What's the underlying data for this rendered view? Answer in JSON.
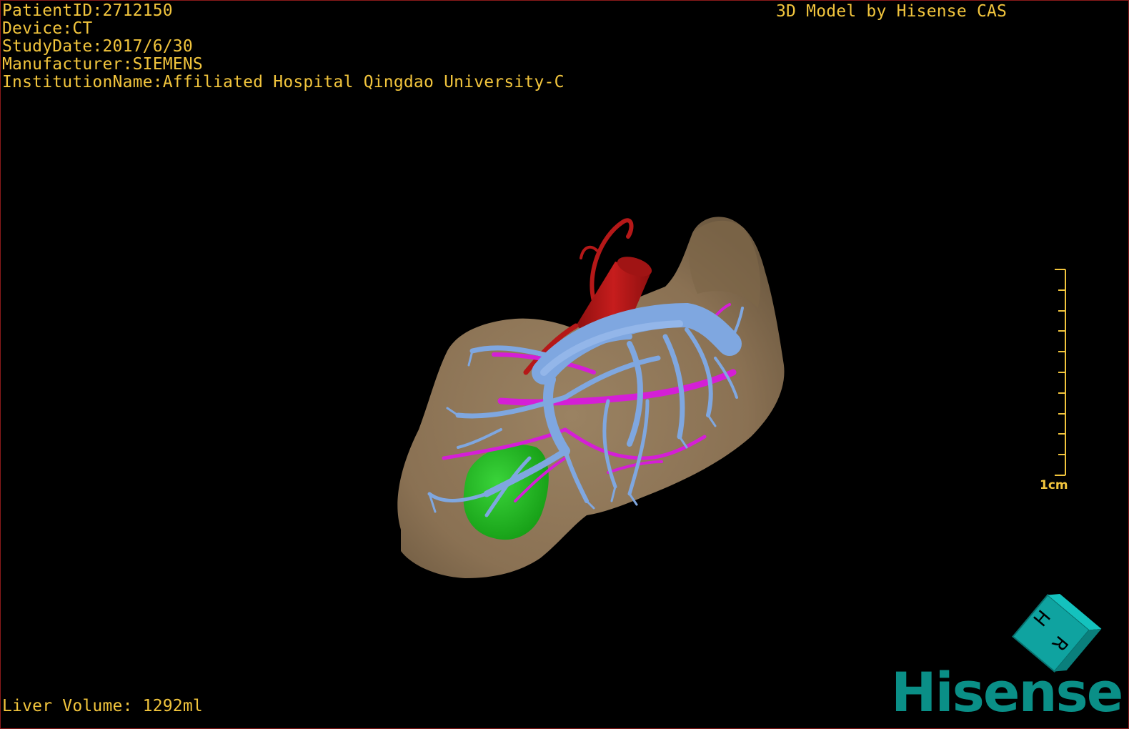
{
  "patient_info": {
    "patient_id": "PatientID:2712150",
    "device": "Device:CT",
    "study_date": "StudyDate:2017/6/30",
    "manufacturer": "Manufacturer:SIEMENS",
    "institution": "InstitutionName:Affiliated Hospital Qingdao University-C"
  },
  "model_credit": "3D Model by Hisense CAS",
  "liver_volume": "Liver Volume: 1292ml",
  "scale_bar": {
    "label": "1cm"
  },
  "orientation_cube": {
    "face_labels": [
      "H",
      "R"
    ]
  },
  "brand_logo": "Hisense",
  "colors": {
    "overlay_text": "#f2c53d",
    "liver": "#8c7456",
    "portal_vein": "#7fa7e0",
    "hepatic_artery": "#b51818",
    "hepatic_vein": "#d41fd6",
    "lesion": "#1fb81f",
    "brand": "#0a8f87",
    "background": "#000000",
    "frame_border": "#8b1a1a"
  },
  "icons": [
    "orientation-cube-icon",
    "hisense-logo"
  ]
}
